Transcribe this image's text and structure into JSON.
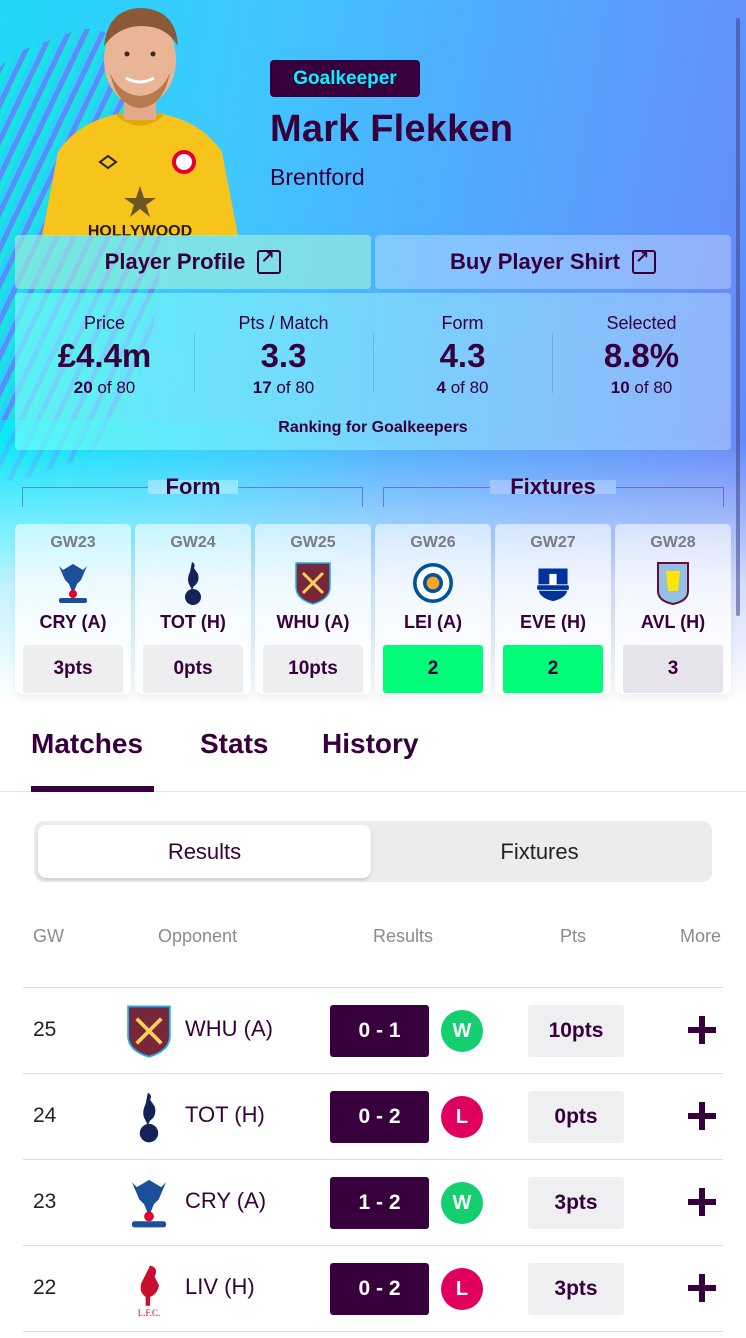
{
  "player": {
    "position": "Goalkeeper",
    "name": "Mark Flekken",
    "team": "Brentford",
    "shirt_sponsor": "HOLLYWOOD"
  },
  "links": {
    "profile_label": "Player Profile",
    "shirt_label": "Buy Player Shirt",
    "icon": "external-link-icon"
  },
  "stats": {
    "items": [
      {
        "label": "Price",
        "value": "£4.4m",
        "rank": "20",
        "of": "of 80"
      },
      {
        "label": "Pts / Match",
        "value": "3.3",
        "rank": "17",
        "of": "of 80"
      },
      {
        "label": "Form",
        "value": "4.3",
        "rank": "4",
        "of": "of 80"
      },
      {
        "label": "Selected",
        "value": "8.8%",
        "rank": "10",
        "of": "of 80"
      }
    ],
    "caption": "Ranking for Goalkeepers"
  },
  "form": {
    "title": "Form",
    "games": [
      {
        "gw": "GW23",
        "opponent": "CRY (A)",
        "crest": "crystal-palace-crest",
        "pts": "3pts"
      },
      {
        "gw": "GW24",
        "opponent": "TOT (H)",
        "crest": "tottenham-crest",
        "pts": "0pts"
      },
      {
        "gw": "GW25",
        "opponent": "WHU (A)",
        "crest": "west-ham-crest",
        "pts": "10pts"
      }
    ]
  },
  "fixtures": {
    "title": "Fixtures",
    "games": [
      {
        "gw": "GW26",
        "opponent": "LEI (A)",
        "crest": "leicester-crest",
        "difficulty": "2",
        "color": "#01fc7a"
      },
      {
        "gw": "GW27",
        "opponent": "EVE (H)",
        "crest": "everton-crest",
        "difficulty": "2",
        "color": "#01fc7a"
      },
      {
        "gw": "GW28",
        "opponent": "AVL (H)",
        "crest": "aston-villa-crest",
        "difficulty": "3",
        "color": "#e7e3ea"
      }
    ]
  },
  "tabs": [
    {
      "label": "Matches",
      "active": true
    },
    {
      "label": "Stats",
      "active": false
    },
    {
      "label": "History",
      "active": false
    }
  ],
  "segmented": {
    "options": [
      "Results",
      "Fixtures"
    ],
    "selected": "Results"
  },
  "table": {
    "headers": [
      "GW",
      "Opponent",
      "Results",
      "Pts",
      "More"
    ],
    "rows": [
      {
        "gw": "25",
        "opponent": "WHU (A)",
        "crest": "west-ham-crest",
        "score": "0 - 1",
        "result": "W",
        "pts": "10pts"
      },
      {
        "gw": "24",
        "opponent": "TOT (H)",
        "crest": "tottenham-crest",
        "score": "0 - 2",
        "result": "L",
        "pts": "0pts"
      },
      {
        "gw": "23",
        "opponent": "CRY (A)",
        "crest": "crystal-palace-crest",
        "score": "1 - 2",
        "result": "W",
        "pts": "3pts"
      },
      {
        "gw": "22",
        "opponent": "LIV (H)",
        "crest": "liverpool-crest",
        "score": "0 - 2",
        "result": "L",
        "pts": "3pts"
      }
    ]
  },
  "colors": {
    "primary": "#37003c",
    "accent_cyan": "#04f5ff",
    "win": "#13cf6f",
    "loss": "#e0005e",
    "fdr_easy": "#01fc7a"
  }
}
